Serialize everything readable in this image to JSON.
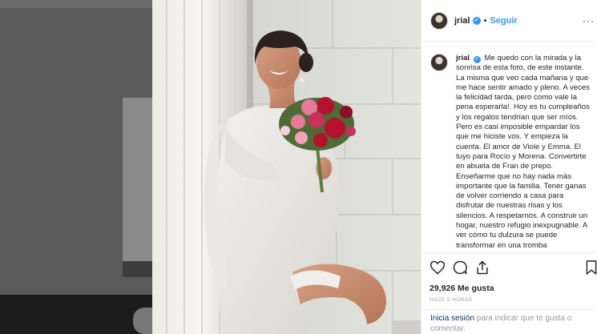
{
  "post": {
    "username": "jrial",
    "verified_mark": "✓",
    "separator": "•",
    "follow_label": "Seguir",
    "more_label": "···",
    "caption": "Me quedo con la mirada y la sonrisa de esta foto, de este instante. La misma que veo cada mañana y que me hace sentir amado y pleno. A veces la felicidad tarda, pero como vale la pena esperarla!. Hoy es tu cumpleaños y los regalos tendrían que ser míos. Pero es casi imposible empardar los que me hiciste vos. Y empieza la cuenta. El amor de Viole y Emma. El tuyo para Rocío y Morena. Convertirte en abuela de Fran de prepo. Enseñarme que no hay nada más importante que la familia. Tener ganas de volver corriendo a casa para disfrutar de nuestras risas y los silencios. A respetarnos. A construir un hogar, nuestro refugio inexpugnable. A ver cómo tu dulzura se puede transformar en una tromba",
    "likes": "29,926 Me gusta",
    "time_ago": "HACE 5 HORAS",
    "login_link": "Inicia sesión",
    "login_rest": " para indicar que te gusta o comentar."
  },
  "icons": {
    "like": "heart-icon",
    "comment": "comment-icon",
    "share": "share-icon",
    "save": "bookmark-icon"
  },
  "colors": {
    "accent": "#3897f0",
    "text": "#262626",
    "muted": "#999999",
    "link": "#003569",
    "bouquet_red": "#b3112e",
    "bouquet_pink": "#e77a98"
  }
}
